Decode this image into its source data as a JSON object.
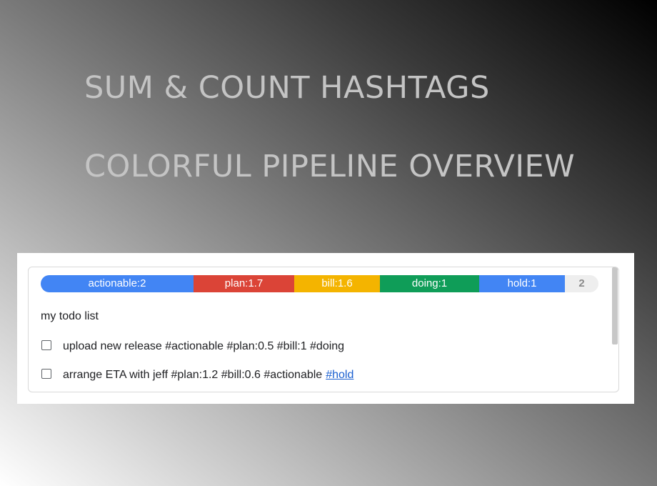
{
  "headlines": {
    "line1": "SUM & COUNT HASHTAGS",
    "line2": "COLORFUL PIPELINE OVERVIEW"
  },
  "pipeline": {
    "segments": [
      {
        "label": "actionable:2",
        "color": "#4285f4"
      },
      {
        "label": "plan:1.7",
        "color": "#db4437"
      },
      {
        "label": "bill:1.6",
        "color": "#f4b400"
      },
      {
        "label": "doing:1",
        "color": "#0f9d58"
      },
      {
        "label": "hold:1",
        "color": "#4285f4"
      }
    ],
    "count": "2"
  },
  "list": {
    "title": "my todo list",
    "items": [
      {
        "text": "upload new release #actionable #plan:0.5 #bill:1 #doing",
        "checked": false
      },
      {
        "text": "arrange ETA with jeff #plan:1.2 #bill:0.6 #actionable",
        "link": "#hold",
        "checked": false
      }
    ]
  }
}
